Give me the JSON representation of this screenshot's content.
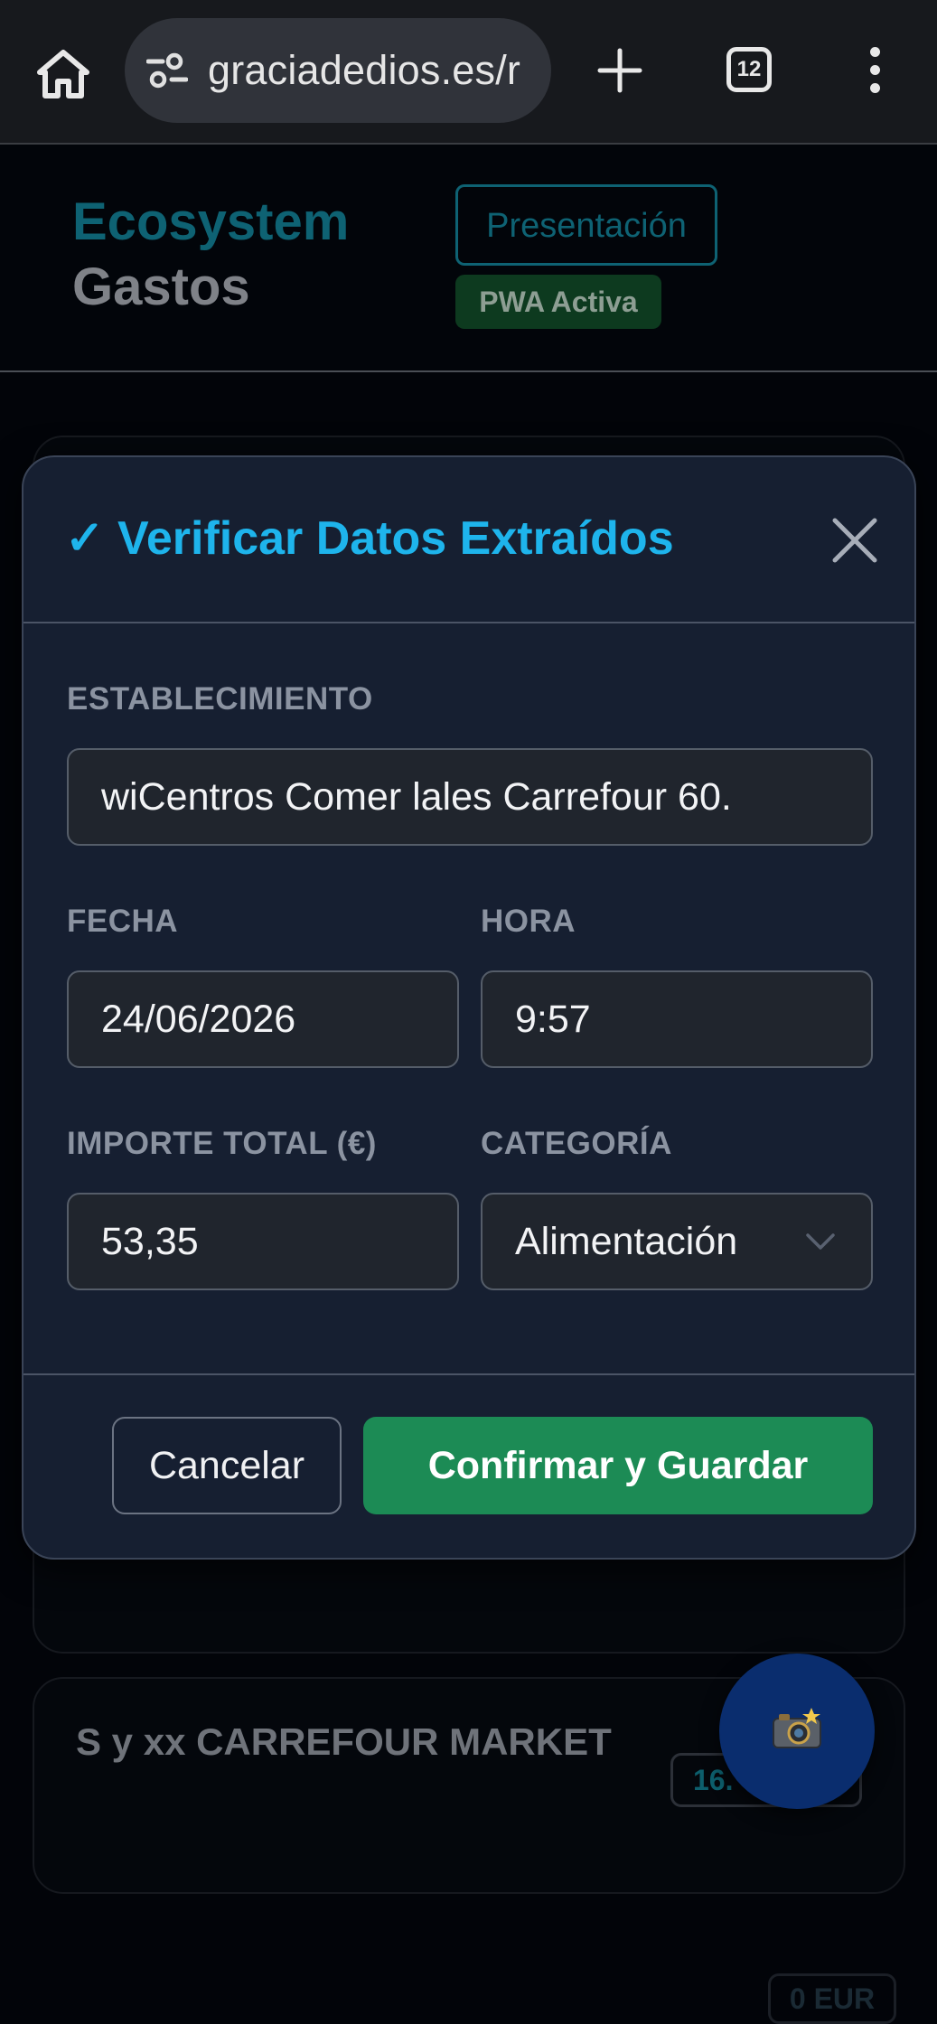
{
  "browser": {
    "url": "graciadedios.es/r",
    "tab_count": "12",
    "icons": [
      "home-icon",
      "site-settings-icon",
      "new-tab-icon",
      "tab-switcher-icon",
      "more-menu-icon"
    ]
  },
  "app_header": {
    "brand_line1": "Ecosystem",
    "brand_line2": "Gastos",
    "presentation_label": "Presentación",
    "pwa_badge": "PWA Activa",
    "colors": {
      "brand": "#0e6273",
      "pwa": "#0d3a1f"
    }
  },
  "background_list": {
    "item1_amount_badge": "0 EUR",
    "item2_title": "S y xx CARREFOUR MARKET",
    "item2_amount_badge": "16.",
    "camera_icon": "camera-flash-icon"
  },
  "modal": {
    "title": "✓ Verificar Datos Extraídos",
    "fields": {
      "establishment_label": "ESTABLECIMIENTO",
      "establishment_value": "wiCentros Comer lales Carrefour 60.",
      "date_label": "FECHA",
      "date_value": "24/06/2026",
      "time_label": "HORA",
      "time_value": "9:57",
      "amount_label": "IMPORTE TOTAL (€)",
      "amount_value": "53,35",
      "category_label": "CATEGORÍA",
      "category_value": "Alimentación"
    },
    "cancel_label": "Cancelar",
    "confirm_label": "Confirmar y Guardar",
    "colors": {
      "title": "#1eb4ec",
      "confirm": "#1c8b55",
      "background": "#161f31"
    }
  }
}
